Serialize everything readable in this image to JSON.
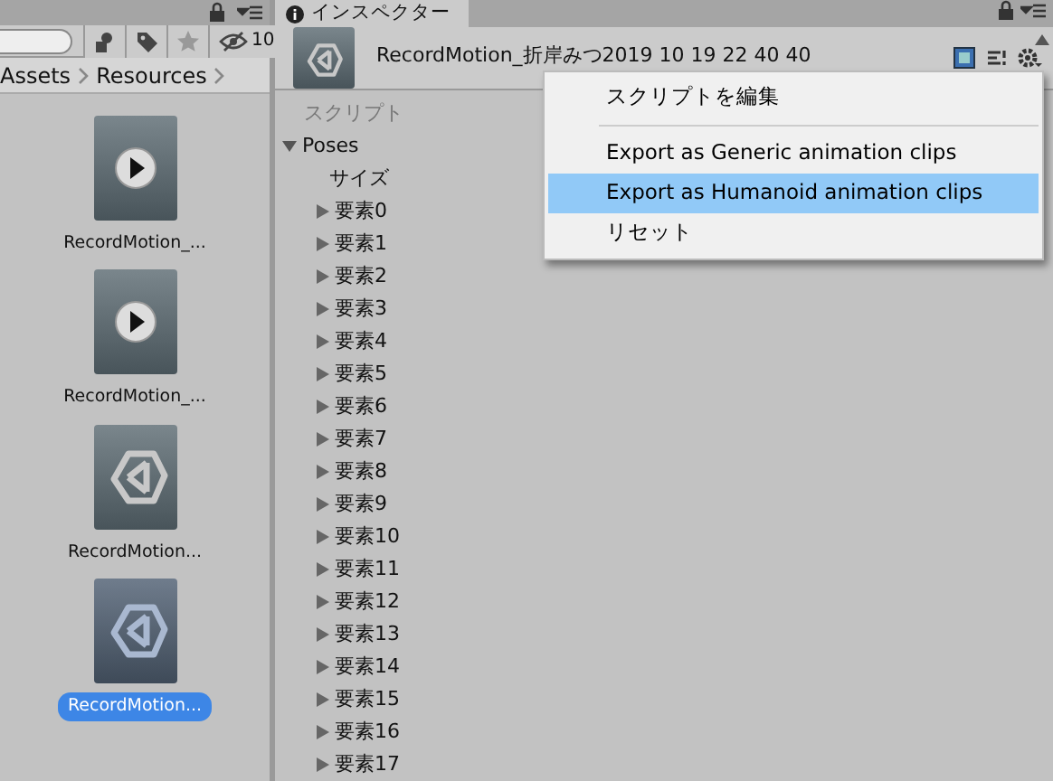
{
  "project_panel": {
    "hidden_count": "10",
    "breadcrumb": [
      "Assets",
      "Resources"
    ],
    "assets": [
      {
        "name": "RecordMotion_...",
        "kind": "clip",
        "selected": false
      },
      {
        "name": "RecordMotion_...",
        "kind": "clip",
        "selected": false
      },
      {
        "name": "RecordMotion...",
        "kind": "asset",
        "selected": false
      },
      {
        "name": "RecordMotion...",
        "kind": "asset",
        "selected": true
      }
    ]
  },
  "inspector": {
    "tab": "インスペクター",
    "title": "RecordMotion_折岸みつ2019 10 19 22 40 40",
    "script_label": "スクリプト",
    "tree": {
      "label": "Poses",
      "expanded": true,
      "size_label": "サイズ",
      "children": [
        {
          "label": "要素0",
          "expanded": false
        },
        {
          "label": "要素1",
          "expanded": false
        },
        {
          "label": "要素2",
          "expanded": false
        },
        {
          "label": "要素3",
          "expanded": false
        },
        {
          "label": "要素4",
          "expanded": false
        },
        {
          "label": "要素5",
          "expanded": false
        },
        {
          "label": "要素6",
          "expanded": false
        },
        {
          "label": "要素7",
          "expanded": false
        },
        {
          "label": "要素8",
          "expanded": false
        },
        {
          "label": "要素9",
          "expanded": false
        },
        {
          "label": "要素10",
          "expanded": false
        },
        {
          "label": "要素11",
          "expanded": false
        },
        {
          "label": "要素12",
          "expanded": false
        },
        {
          "label": "要素13",
          "expanded": false
        },
        {
          "label": "要素14",
          "expanded": false
        },
        {
          "label": "要素15",
          "expanded": false
        },
        {
          "label": "要素16",
          "expanded": false
        },
        {
          "label": "要素17",
          "expanded": false
        }
      ]
    }
  },
  "context_menu": [
    {
      "kind": "item",
      "label": "スクリプトを編集",
      "selected": false
    },
    {
      "kind": "separator"
    },
    {
      "kind": "item",
      "label": "Export as Generic animation clips",
      "selected": false
    },
    {
      "kind": "item",
      "label": "Export as Humanoid animation clips",
      "selected": true
    },
    {
      "kind": "item",
      "label": "リセット",
      "selected": false
    }
  ]
}
